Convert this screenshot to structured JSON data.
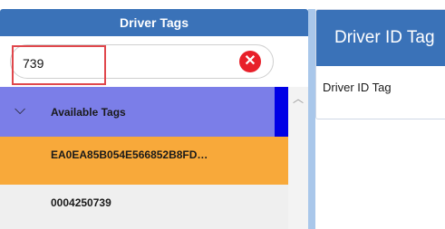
{
  "left_panel": {
    "title": "Driver Tags",
    "search": {
      "value": "739",
      "clear_icon": "close-circle-icon"
    },
    "group": {
      "label": "Available Tags",
      "expanded": true
    },
    "tags": [
      {
        "label": "EA0EA85B054E566852B8FD…",
        "selected": true
      },
      {
        "label": "0004250739",
        "selected": false
      }
    ]
  },
  "right_panel": {
    "title": "Driver ID Tag",
    "field_label": "Driver ID Tag"
  },
  "colors": {
    "header_blue": "#3a72b8",
    "group_purple": "#7b7ee8",
    "selected_orange": "#f8a93a",
    "highlight_red": "#e0474c",
    "clear_red": "#e8202a"
  }
}
